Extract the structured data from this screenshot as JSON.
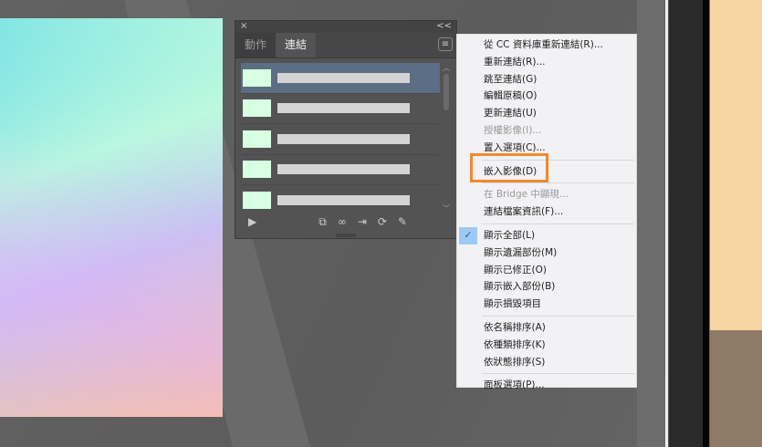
{
  "panel": {
    "close": "×",
    "collapse": "<<",
    "tabs": [
      "動作",
      "連結"
    ],
    "menu_icon": "≡",
    "rows": 5,
    "tools": {
      "play": "▶",
      "relink_cc": "⧉",
      "link": "∞",
      "embed": "⇥",
      "update": "⟳",
      "edit": "✎"
    },
    "scroll_up": "︿",
    "scroll_down": "﹀"
  },
  "menu": {
    "groups": [
      [
        {
          "label": "從 CC 資料庫重新連結(R)...",
          "disabled": false
        },
        {
          "label": "重新連結(R)...",
          "disabled": false
        },
        {
          "label": "跳至連結(G)",
          "disabled": false
        },
        {
          "label": "編輯原稿(O)",
          "disabled": false
        },
        {
          "label": "更新連結(U)",
          "disabled": false
        },
        {
          "label": "授權影像(I)...",
          "disabled": true
        },
        {
          "label": "置入選項(C)...",
          "disabled": false
        }
      ],
      [
        {
          "label": "嵌入影像(D)",
          "disabled": false,
          "highlighted": true
        }
      ],
      [
        {
          "label": "在 Bridge 中顯現...",
          "disabled": true
        },
        {
          "label": "連結檔案資訊(F)...",
          "disabled": false
        }
      ],
      [
        {
          "label": "顯示全部(L)",
          "checked": true
        },
        {
          "label": "顯示遺漏部份(M)"
        },
        {
          "label": "顯示已修正(O)"
        },
        {
          "label": "顯示嵌入部份(B)"
        },
        {
          "label": "顯示損毀項目"
        }
      ],
      [
        {
          "label": "依名稱排序(A)"
        },
        {
          "label": "依種類排序(K)"
        },
        {
          "label": "依狀態排序(S)"
        }
      ],
      [
        {
          "label": "面板選項(P)..."
        }
      ]
    ],
    "check": "✓"
  },
  "colors": {
    "highlight": "#f28a2c",
    "selected_row": "#5b6e83",
    "thumb": "#d7ffe2"
  }
}
